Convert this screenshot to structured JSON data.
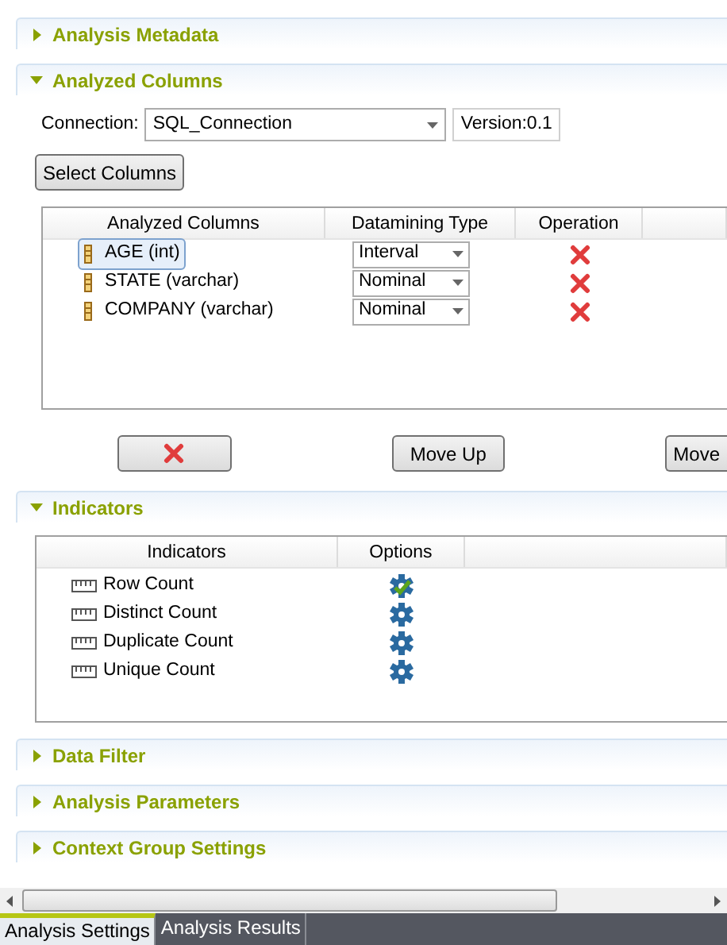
{
  "sections": [
    {
      "kind": "plain",
      "title": "Analysis Metadata",
      "expanded": false
    },
    {
      "kind": "columns",
      "title": "Analyzed Columns",
      "expanded": true,
      "connection": {
        "label": "Connection:",
        "value": "SQL_Connection",
        "version": "Version:0.1"
      },
      "select_button": "Select Columns",
      "table": {
        "columns": [
          "Analyzed Columns",
          "Datamining Type",
          "Operation"
        ],
        "rows": [
          {
            "name": "AGE (int)",
            "type": "Interval",
            "selected": true
          },
          {
            "name": "STATE (varchar)",
            "type": "Nominal",
            "selected": false
          },
          {
            "name": "COMPANY (varchar)",
            "type": "Nominal",
            "selected": false
          }
        ]
      },
      "buttons": [
        "Move Up",
        "Move"
      ]
    },
    {
      "kind": "indicators",
      "title": "Indicators",
      "expanded": true,
      "table": {
        "columns": [
          "Indicators",
          "Options"
        ],
        "rows": [
          {
            "name": "Row Count",
            "configured": true
          },
          {
            "name": "Distinct Count",
            "configured": false
          },
          {
            "name": "Duplicate Count",
            "configured": false
          },
          {
            "name": "Unique Count",
            "configured": false
          }
        ]
      }
    },
    {
      "kind": "plain",
      "title": "Data Filter",
      "expanded": false
    },
    {
      "kind": "plain",
      "title": "Analysis Parameters",
      "expanded": false
    },
    {
      "kind": "plain",
      "title": "Context Group Settings",
      "expanded": false
    }
  ],
  "bottom_tabs": [
    {
      "label": "Analysis Settings",
      "selected": true
    },
    {
      "label": "Analysis Results",
      "selected": false
    }
  ]
}
